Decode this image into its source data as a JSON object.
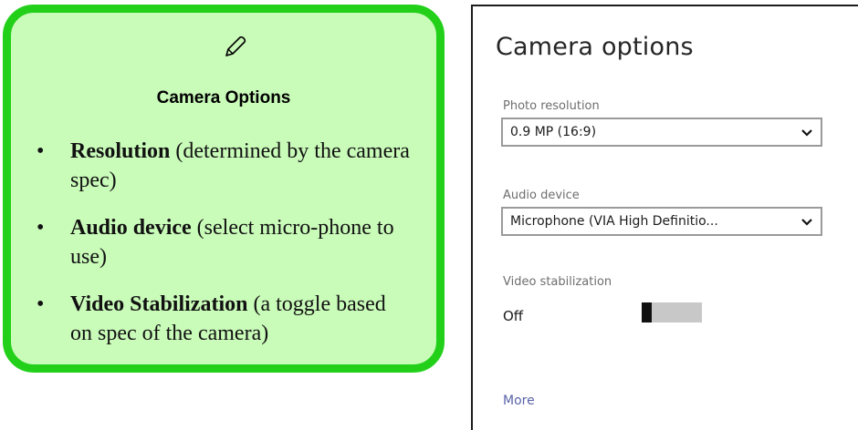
{
  "note": {
    "icon": "pencil-icon",
    "heading": "Camera Options",
    "items": [
      {
        "bold": "Resolution",
        "text": " (determined by the camera spec)"
      },
      {
        "bold": "Audio device",
        "text": " (select micro-phone to use)"
      },
      {
        "bold": "Video Stabilization",
        "text": " (a toggle based on spec of the camera)"
      }
    ],
    "colors": {
      "border": "#22d01a",
      "fill": "#c9fbb9"
    }
  },
  "panel": {
    "title": "Camera options",
    "photo_resolution": {
      "label": "Photo resolution",
      "value": "0.9 MP (16:9)"
    },
    "audio_device": {
      "label": "Audio device",
      "value": "Microphone (VIA High Definitio..."
    },
    "video_stabilization": {
      "label": "Video stabilization",
      "state": "Off",
      "on": false
    },
    "more_link": "More",
    "colors": {
      "link": "#5a63a8"
    }
  }
}
